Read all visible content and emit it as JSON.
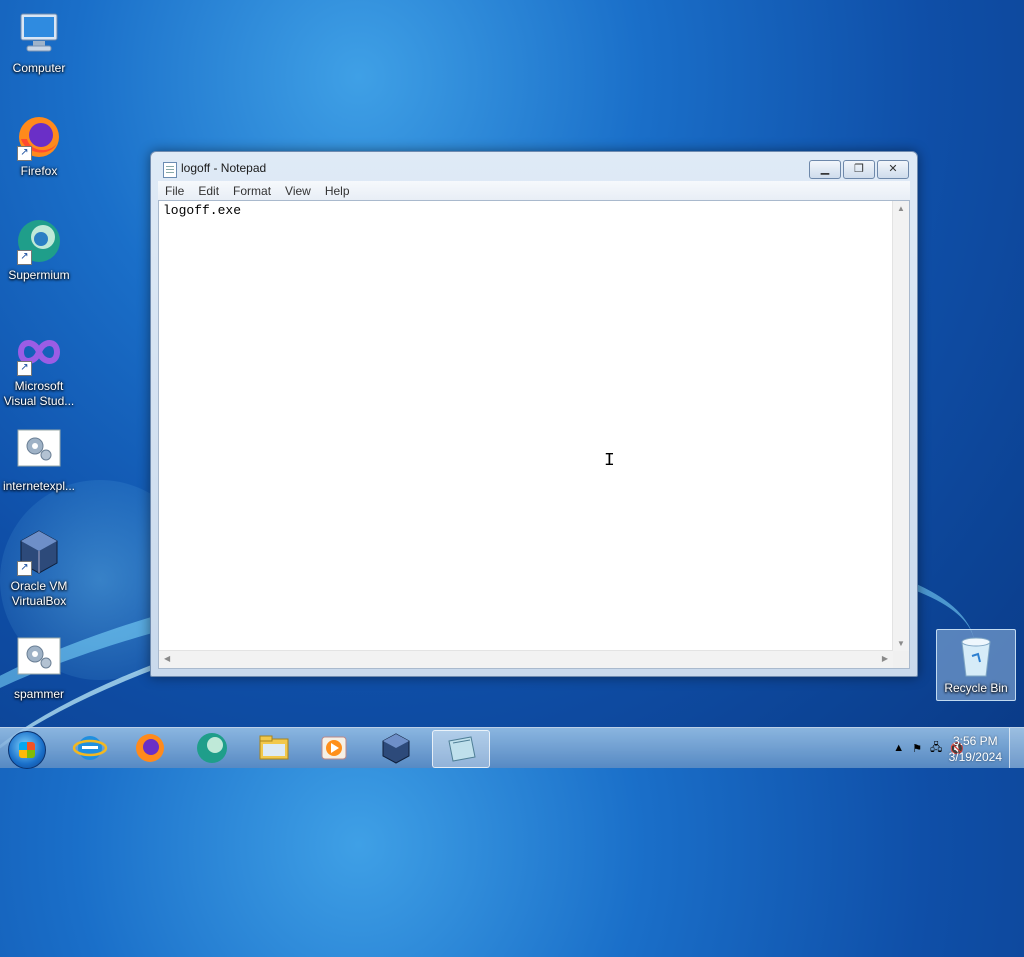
{
  "desktop": {
    "icons": [
      {
        "label": "Computer",
        "icon": "computer-icon"
      },
      {
        "label": "Firefox",
        "icon": "firefox-icon"
      },
      {
        "label": "Supermium",
        "icon": "supermium-icon"
      },
      {
        "label": "Microsoft Visual Stud...",
        "icon": "visual-studio-icon"
      },
      {
        "label": "internetexpl...",
        "icon": "settings-file-icon"
      },
      {
        "label": "Oracle VM VirtualBox",
        "icon": "virtualbox-icon"
      },
      {
        "label": "spammer",
        "icon": "settings-file-icon"
      },
      {
        "label": "Recycle Bin",
        "icon": "recycle-bin-icon"
      }
    ]
  },
  "notepad": {
    "title": "logoff - Notepad",
    "menu": [
      "File",
      "Edit",
      "Format",
      "View",
      "Help"
    ],
    "content": "logoff.exe"
  },
  "taskbar": {
    "apps": [
      "internet-explorer-icon",
      "firefox-icon",
      "supermium-icon",
      "file-explorer-icon",
      "media-player-icon",
      "virtualbox-icon",
      "notepad-icon"
    ],
    "active_app": "notepad-icon",
    "clock_time": "3:56 PM",
    "clock_date": "3/19/2024"
  }
}
